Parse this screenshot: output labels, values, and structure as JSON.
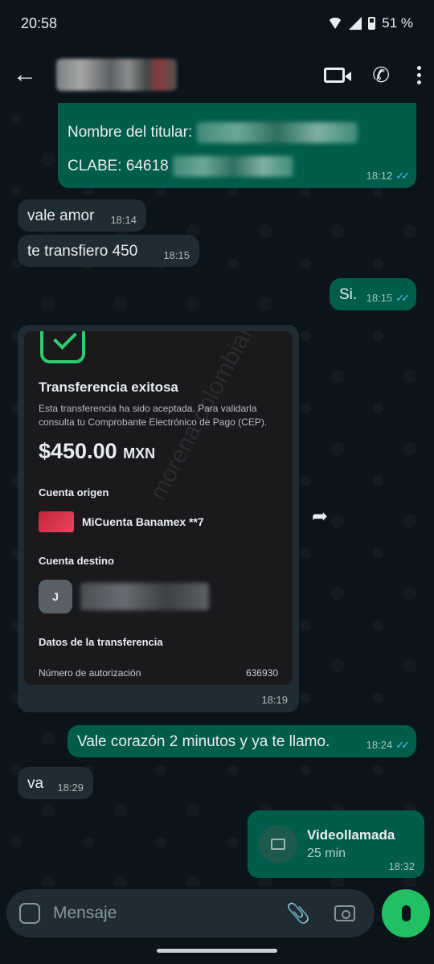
{
  "status": {
    "time": "20:58",
    "battery": "51 %"
  },
  "header": {
    "back_icon": "arrow-back-icon"
  },
  "messages": {
    "m1_line1_label": "Nombre del titular:",
    "m1_line2_label": "CLABE: 64618",
    "m1_time": "18:12",
    "m2_text": "vale amor",
    "m2_time": "18:14",
    "m3_text": "te transfiero 450",
    "m3_time": "18:15",
    "m4_text": "Si.",
    "m4_time": "18:15",
    "m6_text": "Vale corazón 2 minutos y ya te llamo.",
    "m6_time": "18:24",
    "m7_text": "va",
    "m7_time": "18:29"
  },
  "receipt": {
    "title": "Transferencia exitosa",
    "subtitle": "Esta transferencia ha sido aceptada. Para validarla consulta tu Comprobante Electrónico de Pago (CEP).",
    "amount": "$450.00",
    "currency": "MXN",
    "origin_label": "Cuenta origen",
    "origin_account": "MiCuenta Banamex **7",
    "dest_label": "Cuenta destino",
    "dest_initial": "J",
    "details_label": "Datos de la transferencia",
    "auth_label": "Número de autorización",
    "auth_value": "636930",
    "time": "18:19",
    "watermark": "morena colombiana"
  },
  "videocall": {
    "title": "Videollamada",
    "duration": "25 min",
    "time": "18:32"
  },
  "composer": {
    "placeholder": "Mensaje"
  },
  "colors": {
    "outgoing": "#005c4b",
    "incoming": "#202c33",
    "accent": "#21c063",
    "ticks": "#53bdeb"
  }
}
